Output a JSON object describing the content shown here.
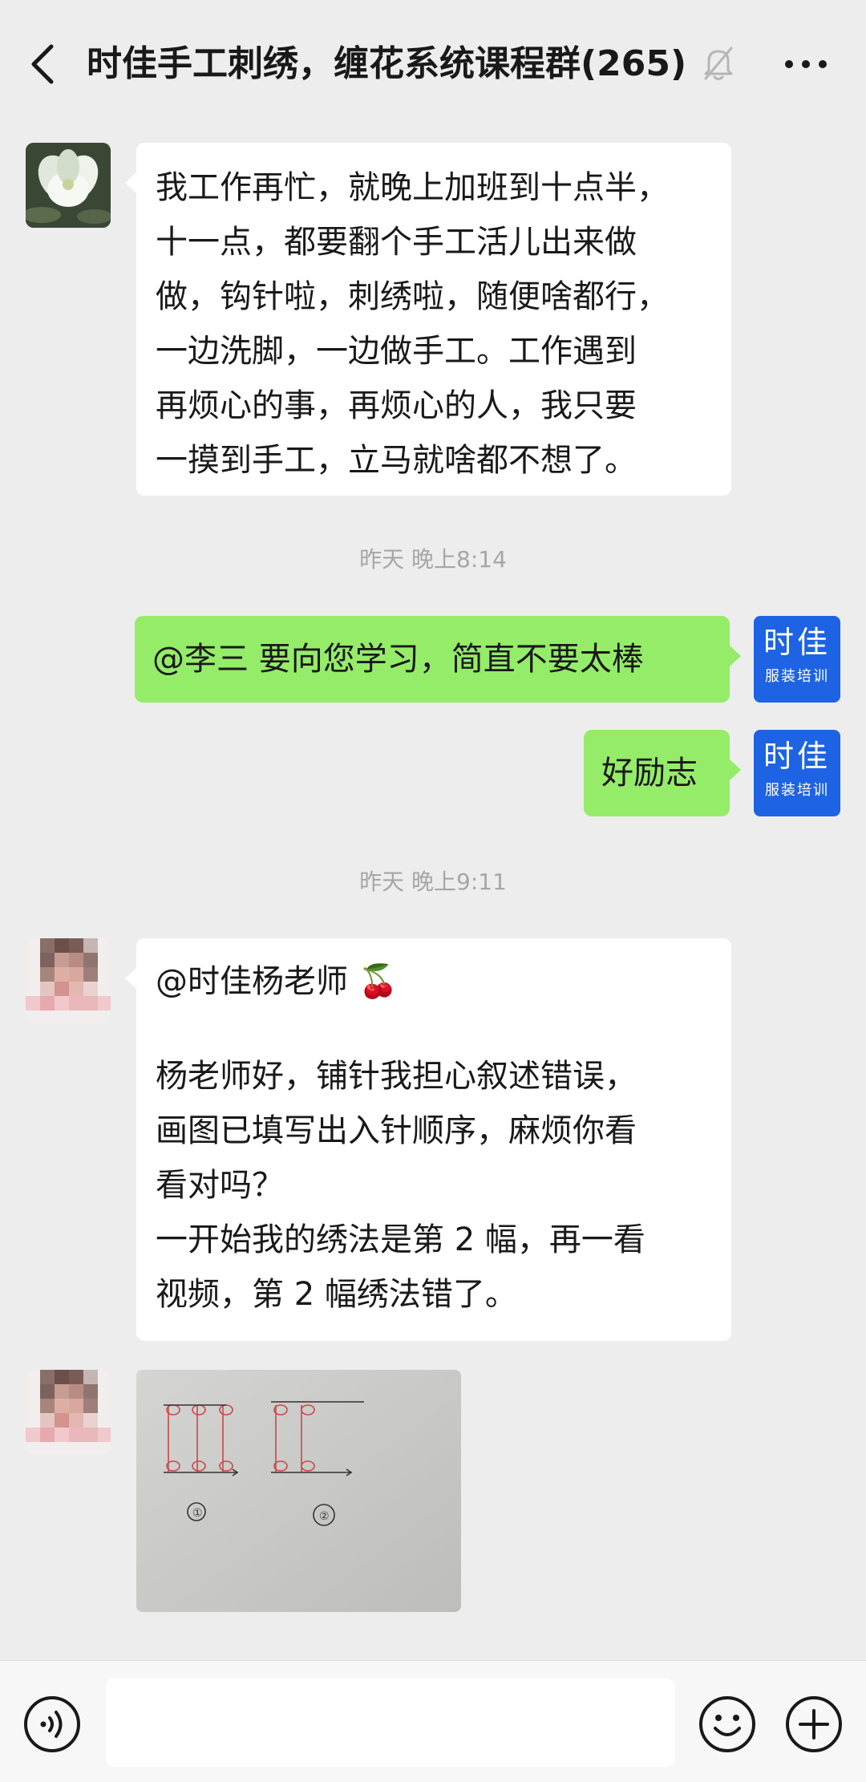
{
  "header": {
    "title": "时佳手工刺绣，缠花系统课程群(265)",
    "back_icon": "chevron-left-icon",
    "mute_icon": "bell-off-icon",
    "more_icon": "more-horizontal-icon"
  },
  "colors": {
    "background": "#ededed",
    "self_bubble": "#95ec69",
    "other_bubble": "#ffffff",
    "brand_avatar": "#1d63e3",
    "timestamp_text": "#a6a6a6"
  },
  "brand_avatar": {
    "line1": "时佳",
    "line2": "服装培训"
  },
  "messages": [
    {
      "type": "text",
      "from": "other",
      "lines": [
        "我工作再忙，就晚上加班到十点半，",
        "十一点，都要翻个手工活儿出来做",
        "做，钩针啦，刺绣啦，随便啥都行，",
        "一边洗脚，一边做手工。工作遇到",
        "再烦心的事，再烦心的人，我只要",
        "一摸到手工，立马就啥都不想了。"
      ]
    },
    {
      "type": "time",
      "text": "昨天 晚上8:14"
    },
    {
      "type": "text",
      "from": "self",
      "lines": [
        "@李三 要向您学习，简直不要太棒"
      ]
    },
    {
      "type": "text",
      "from": "self",
      "lines": [
        "好励志"
      ]
    },
    {
      "type": "time",
      "text": "昨天 晚上9:11"
    },
    {
      "type": "text",
      "from": "other",
      "lines": [
        "@时佳杨老师 🍒",
        "",
        "杨老师好，铺针我担心叙述错误，",
        "画图已填写出入针顺序，麻烦你看",
        "看对吗？",
        "一开始我的绣法是第 2 幅，再一看",
        "视频，第 2 幅绣法错了。"
      ]
    },
    {
      "type": "image",
      "from": "other",
      "image_content": {
        "figure_labels": [
          "①",
          "②"
        ]
      }
    }
  ],
  "bottom_bar": {
    "voice_icon": "voice-icon",
    "emoji_icon": "emoji-icon",
    "plus_icon": "plus-icon",
    "input_value": ""
  }
}
